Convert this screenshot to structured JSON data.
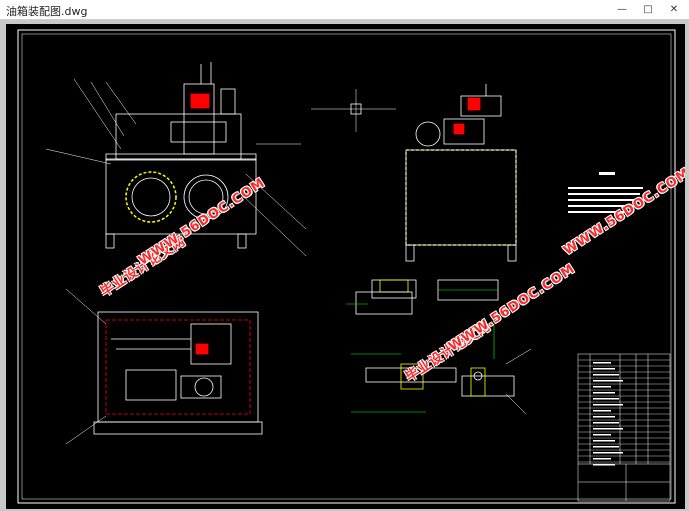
{
  "window": {
    "title": "油箱装配图.dwg"
  },
  "watermark": {
    "text_cn": "毕业设计论文网",
    "url": "WWW.56DOC.COM"
  },
  "colors": {
    "background": "#000000",
    "frame": "#ffffff",
    "geometry": "#ffffff",
    "annotation": "#00ff00",
    "accent": "#ff0000",
    "hidden": "#ffff00",
    "watermark": "#ff2a2a"
  },
  "icons": {
    "minimize": "minimize-icon",
    "maximize": "maximize-icon",
    "close": "close-icon",
    "crosshair": "crosshair-icon"
  }
}
